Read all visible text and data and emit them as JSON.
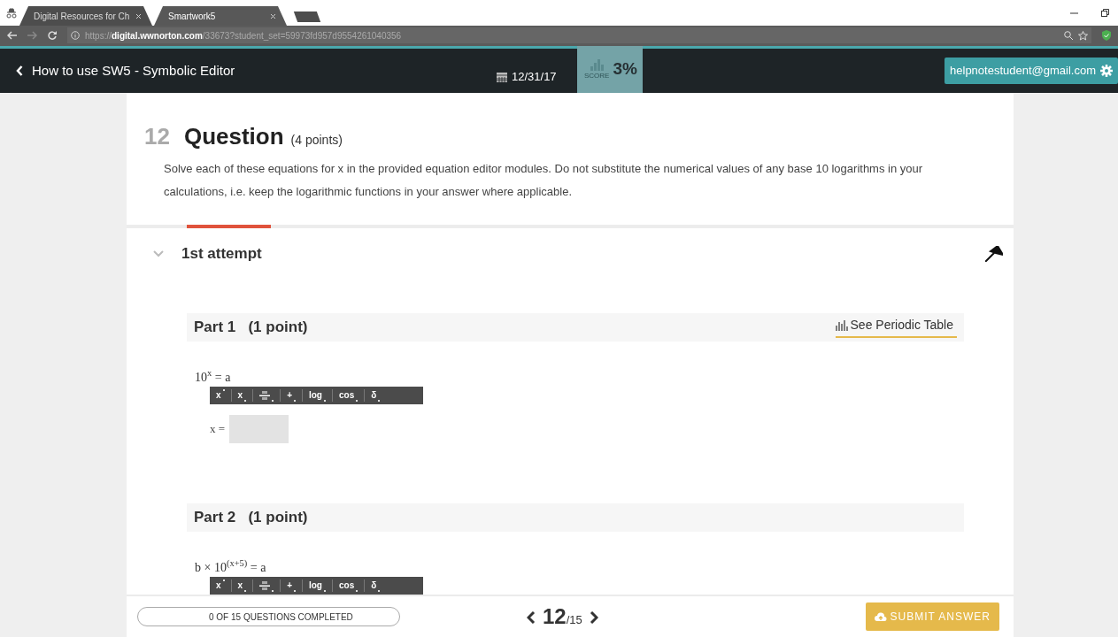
{
  "browser": {
    "tabs": [
      {
        "title": "Digital Resources for Ch",
        "selected": false
      },
      {
        "title": "Smartwork5",
        "selected": true
      }
    ],
    "url": "https://**digital.wwnorton.com**/33673?student_set=59973fd957d9554261040356"
  },
  "header": {
    "back_label": "How to use SW5 - Symbolic Editor",
    "due_date": "12/31/17",
    "score_label": "SCORE",
    "score": "3%",
    "user": "helpnotestudent@gmail.com"
  },
  "question": {
    "number": "12",
    "title": "Question",
    "points": "(4 points)",
    "text": "Solve each of these equations for x in the provided equation editor modules. Do not substitute the numerical values of any base 10 logarithms in your calculations, i.e. keep the logarithmic functions in your answer where applicable."
  },
  "attempt": {
    "label": "1st attempt",
    "expanded": true
  },
  "parts": [
    {
      "title": "Part 1",
      "points": "(1 point)",
      "link": "See Periodic Table",
      "equation": "10$^{x}$ = a",
      "answer_label": "x =",
      "toolbar": [
        {
          "kind": "sup",
          "label": "x"
        },
        {
          "kind": "sub",
          "label": "x"
        },
        {
          "kind": "fraction"
        },
        {
          "kind": "text",
          "label": "+"
        },
        {
          "kind": "text",
          "label": "log"
        },
        {
          "kind": "text",
          "label": "cos"
        },
        {
          "kind": "text",
          "label": "δ"
        }
      ]
    },
    {
      "title": "Part 2",
      "points": "(1 point)",
      "equation": "b × 10$^{(x+5)}$ = a",
      "toolbar": [
        {
          "kind": "sup",
          "label": "x"
        },
        {
          "kind": "sub",
          "label": "x"
        },
        {
          "kind": "fraction"
        },
        {
          "kind": "text",
          "label": "+"
        },
        {
          "kind": "text",
          "label": "log"
        },
        {
          "kind": "text",
          "label": "cos"
        },
        {
          "kind": "text",
          "label": "δ"
        }
      ]
    }
  ],
  "footer": {
    "progress": "0 OF 15 QUESTIONS COMPLETED",
    "level": 0,
    "current": "12",
    "total": "/15",
    "submit": "SUBMIT ANSWER"
  }
}
